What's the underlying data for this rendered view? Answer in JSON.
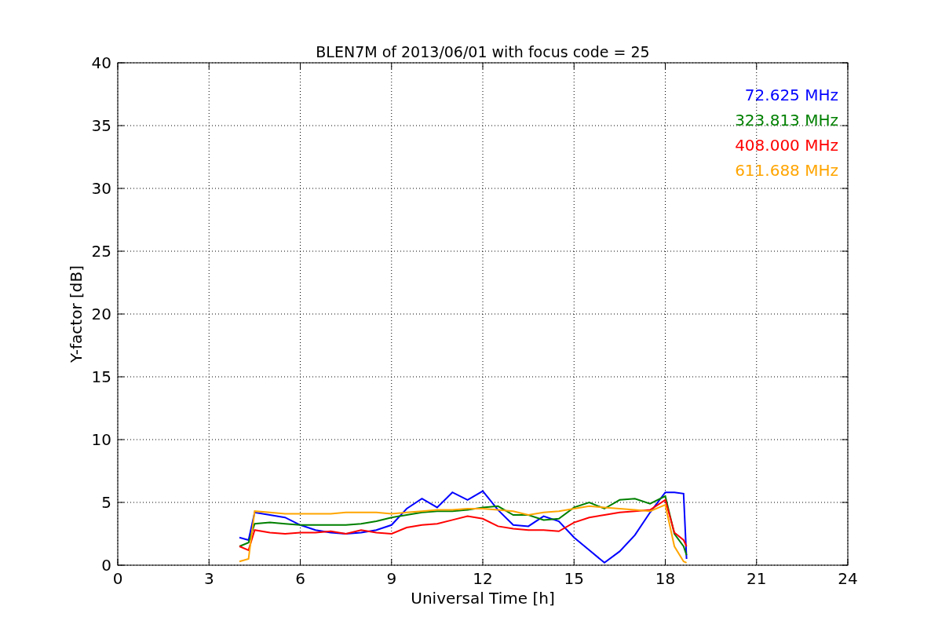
{
  "figure": {
    "chart_data": {
      "type": "line",
      "title": "BLEN7M of 2013/06/01 with focus code = 25",
      "xlabel": "Universal Time [h]",
      "ylabel": "Y-factor [dB]",
      "grid": true,
      "xlim": [
        0,
        24
      ],
      "ylim": [
        0,
        40
      ],
      "xticks": [
        0,
        3,
        6,
        9,
        12,
        15,
        18,
        21,
        24
      ],
      "yticks": [
        0,
        5,
        10,
        15,
        20,
        25,
        30,
        35,
        40
      ],
      "x": [
        4,
        4.3,
        4.5,
        5,
        5.5,
        6,
        6.5,
        7,
        7.5,
        8,
        8.5,
        9,
        9.5,
        10,
        10.5,
        11,
        11.5,
        12,
        12.5,
        13,
        13.5,
        14,
        14.5,
        15,
        15.5,
        16,
        16.5,
        17,
        17.5,
        18,
        18.3,
        18.6,
        18.7
      ],
      "series": [
        {
          "name": "72.625 MHz",
          "color": "#0000ff",
          "values": [
            2.2,
            2.0,
            4.2,
            4.0,
            3.8,
            3.2,
            2.8,
            2.6,
            2.5,
            2.6,
            2.8,
            3.2,
            4.5,
            5.3,
            4.6,
            5.8,
            5.2,
            5.9,
            4.4,
            3.2,
            3.1,
            3.9,
            3.5,
            2.2,
            1.2,
            0.2,
            1.1,
            2.4,
            4.2,
            5.8,
            5.8,
            5.7,
            0.5
          ]
        },
        {
          "name": "323.813 MHz",
          "color": "#008000",
          "values": [
            1.5,
            1.8,
            3.3,
            3.4,
            3.3,
            3.2,
            3.2,
            3.2,
            3.2,
            3.3,
            3.5,
            3.8,
            4.0,
            4.2,
            4.3,
            4.3,
            4.4,
            4.6,
            4.7,
            4.0,
            4.0,
            3.6,
            3.7,
            4.6,
            5.0,
            4.5,
            5.2,
            5.3,
            4.9,
            5.5,
            2.5,
            1.5,
            0.8
          ]
        },
        {
          "name": "408.000 MHz",
          "color": "#ff0000",
          "values": [
            1.5,
            1.2,
            2.8,
            2.6,
            2.5,
            2.6,
            2.6,
            2.7,
            2.5,
            2.8,
            2.6,
            2.5,
            3.0,
            3.2,
            3.3,
            3.6,
            3.9,
            3.7,
            3.1,
            2.9,
            2.8,
            2.8,
            2.7,
            3.4,
            3.8,
            4.0,
            4.2,
            4.3,
            4.4,
            5.2,
            2.6,
            2.0,
            1.5
          ]
        },
        {
          "name": "611.688 MHz",
          "color": "#ffa500",
          "values": [
            0.3,
            0.5,
            4.3,
            4.2,
            4.1,
            4.1,
            4.1,
            4.1,
            4.2,
            4.2,
            4.2,
            4.1,
            4.2,
            4.3,
            4.4,
            4.4,
            4.5,
            4.5,
            4.4,
            4.3,
            4.0,
            4.2,
            4.3,
            4.5,
            4.7,
            4.6,
            4.5,
            4.4,
            4.3,
            4.8,
            1.5,
            0.3,
            0.2
          ]
        }
      ]
    }
  }
}
